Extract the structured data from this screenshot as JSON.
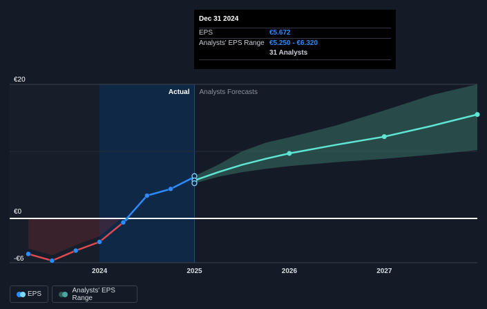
{
  "tooltip": {
    "date": "Dec 31 2024",
    "eps_label": "EPS",
    "eps_value": "€5.672",
    "range_label": "Analysts' EPS Range",
    "range_value": "€5.250 - €6.320",
    "analysts": "31 Analysts"
  },
  "legend": {
    "eps": "EPS",
    "range": "Analysts' EPS Range"
  },
  "colors": {
    "background": "#151b26",
    "actual_positive": "#2b8cff",
    "actual_negative": "#e0494f",
    "forecast": "#5ee6d2",
    "range_band": "#2f5c55"
  },
  "chart_data": {
    "type": "line",
    "ylim": [
      -6.6,
      20
    ],
    "xlim": [
      2023.25,
      2027.98
    ],
    "y_ticks": [
      {
        "value": 20,
        "label": "€20"
      },
      {
        "value": 0,
        "label": "€0"
      },
      {
        "value": -6,
        "label": "-€6"
      }
    ],
    "x_ticks": [
      {
        "value": 2024.0,
        "label": "2024"
      },
      {
        "value": 2025.0,
        "label": "2025"
      },
      {
        "value": 2026.0,
        "label": "2026"
      },
      {
        "value": 2027.0,
        "label": "2027"
      }
    ],
    "regions": {
      "actual": "Actual",
      "forecast": "Analysts Forecasts",
      "split": 2025.0,
      "highlight_start": 2024.0
    },
    "series": [
      {
        "name": "EPS",
        "x": [
          2023.25,
          2023.5,
          2023.75,
          2024.0,
          2024.25,
          2024.5,
          2024.75,
          2025.0
        ],
        "values": [
          -5.3,
          -6.3,
          -4.8,
          -3.5,
          -0.6,
          3.4,
          4.4,
          6.2
        ]
      },
      {
        "name": "Analysts' EPS Range",
        "x": [
          2025.0,
          2025.25,
          2025.5,
          2025.75,
          2026.0,
          2026.5,
          2027.0,
          2027.5,
          2027.98
        ],
        "low": [
          5.25,
          6.2,
          6.9,
          7.4,
          7.8,
          8.4,
          8.9,
          9.5,
          10.2
        ],
        "values": [
          5.672,
          6.9,
          8.0,
          8.9,
          9.7,
          11.0,
          12.2,
          13.8,
          15.5
        ],
        "high": [
          6.32,
          8.0,
          10.0,
          11.3,
          12.1,
          13.9,
          16.1,
          18.4,
          20.0
        ]
      }
    ]
  }
}
